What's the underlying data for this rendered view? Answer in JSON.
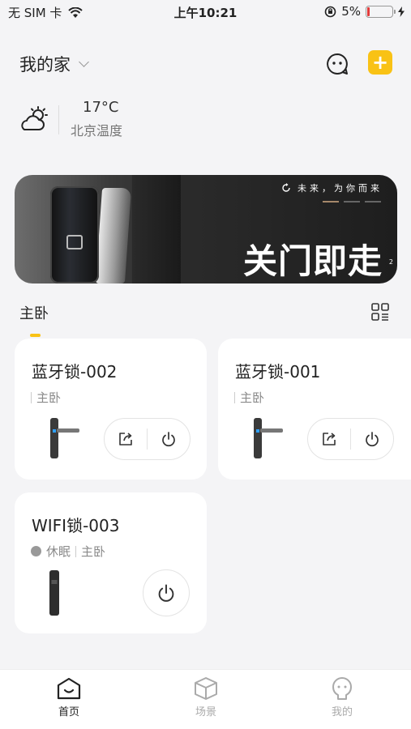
{
  "status_bar": {
    "carrier": "无 SIM 卡",
    "time": "上午10:21",
    "battery": "5%"
  },
  "header": {
    "home_name": "我的家"
  },
  "weather": {
    "temperature": "17°C",
    "label": "北京温度"
  },
  "banner": {
    "tagline": "未来，为你而来",
    "headline": "关门即走",
    "page_indicator": "2"
  },
  "room": {
    "name": "主卧"
  },
  "devices": [
    {
      "name": "蓝牙锁-002",
      "room": "主卧"
    },
    {
      "name": "蓝牙锁-001",
      "room": "主卧"
    },
    {
      "name": "WIFI锁-003",
      "status": "休眠",
      "room": "主卧"
    }
  ],
  "tabs": [
    {
      "label": "首页",
      "icon": "home-icon",
      "active": true
    },
    {
      "label": "场景",
      "icon": "cube-icon",
      "active": false
    },
    {
      "label": "我的",
      "icon": "profile-icon",
      "active": false
    }
  ],
  "colors": {
    "accent": "#f9c215",
    "background": "#f4f4f6",
    "battery_low": "#e23b3b"
  }
}
